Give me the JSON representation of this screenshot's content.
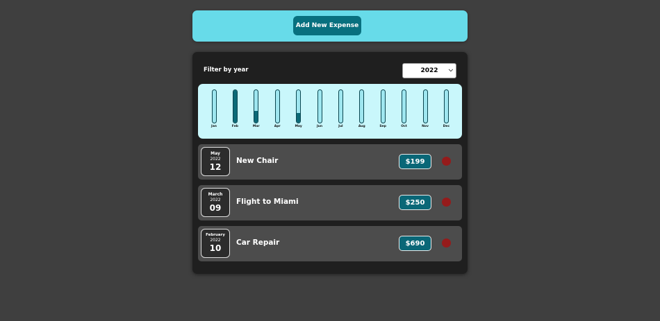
{
  "header": {
    "add_button_label": "Add New Expense"
  },
  "filter": {
    "label": "Filter by year",
    "selected_year": "2022"
  },
  "chart_data": {
    "type": "bar",
    "categories": [
      "Jan",
      "Feb",
      "Mar",
      "Apr",
      "May",
      "Jun",
      "Jul",
      "Aug",
      "Sep",
      "Oct",
      "Nov",
      "Dec"
    ],
    "values": [
      0,
      1.0,
      0.36,
      0,
      0.29,
      0,
      0,
      0,
      0,
      0,
      0,
      0
    ],
    "ylim": [
      0,
      1
    ],
    "colors": {
      "track": "#9fe7f0",
      "fill": "#0b6a77",
      "background": "#c9f7fb"
    }
  },
  "expenses": [
    {
      "month": "May",
      "year": "2022",
      "day": "12",
      "title": "New Chair",
      "amount": "$199"
    },
    {
      "month": "March",
      "year": "2022",
      "day": "09",
      "title": "Flight to Miami",
      "amount": "$250"
    },
    {
      "month": "February",
      "year": "2022",
      "day": "10",
      "title": "Car Repair",
      "amount": "$690"
    }
  ],
  "colors": {
    "accent": "#67dbe9",
    "button": "#08707f",
    "delete": "#951b1b"
  }
}
